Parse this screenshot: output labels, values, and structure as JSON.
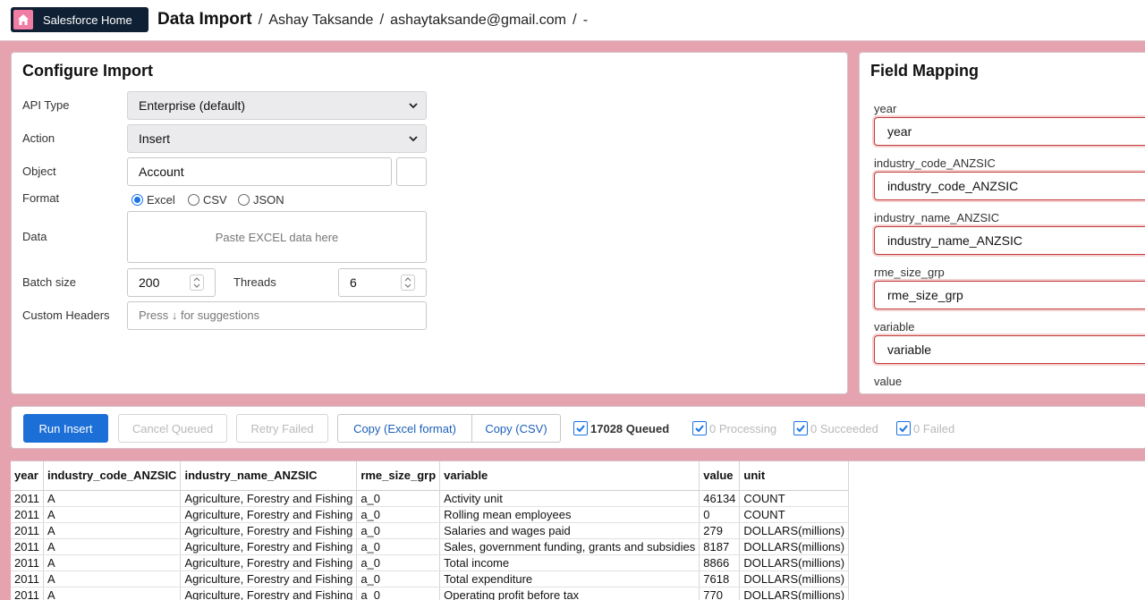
{
  "header": {
    "home_label": "Salesforce Home",
    "title": "Data Import",
    "separator": "/",
    "user_name": "Ashay Taksande",
    "user_email": "ashaytaksande@gmail.com",
    "trailing": "-"
  },
  "configure": {
    "title": "Configure Import",
    "api_type_label": "API Type",
    "api_type_value": "Enterprise (default)",
    "action_label": "Action",
    "action_value": "Insert",
    "object_label": "Object",
    "object_value": "Account",
    "format_label": "Format",
    "format_options": [
      "Excel",
      "CSV",
      "JSON"
    ],
    "format_selected": "Excel",
    "data_label": "Data",
    "data_placeholder": "Paste EXCEL data here",
    "batch_label": "Batch size",
    "batch_value": "200",
    "threads_label": "Threads",
    "threads_value": "6",
    "headers_label": "Custom Headers",
    "headers_placeholder": "Press ↓ for suggestions"
  },
  "field_mapping": {
    "title": "Field Mapping",
    "fields": [
      {
        "label": "year",
        "value": "year"
      },
      {
        "label": "industry_code_ANZSIC",
        "value": "industry_code_ANZSIC"
      },
      {
        "label": "industry_name_ANZSIC",
        "value": "industry_name_ANZSIC"
      },
      {
        "label": "rme_size_grp",
        "value": "rme_size_grp"
      },
      {
        "label": "variable",
        "value": "variable"
      },
      {
        "label": "value",
        "value": ""
      }
    ]
  },
  "actions": {
    "run_label": "Run Insert",
    "cancel_label": "Cancel Queued",
    "retry_label": "Retry Failed",
    "copy_excel_label": "Copy (Excel format)",
    "copy_csv_label": "Copy (CSV)",
    "status": [
      {
        "label": "17028 Queued",
        "active": true
      },
      {
        "label": "0 Processing",
        "active": false
      },
      {
        "label": "0 Succeeded",
        "active": false
      },
      {
        "label": "0 Failed",
        "active": false
      }
    ]
  },
  "table": {
    "columns": [
      "year",
      "industry_code_ANZSIC",
      "industry_name_ANZSIC",
      "rme_size_grp",
      "variable",
      "value",
      "unit"
    ],
    "rows": [
      [
        "2011",
        "A",
        "Agriculture, Forestry and Fishing",
        "a_0",
        "Activity unit",
        "46134",
        "COUNT"
      ],
      [
        "2011",
        "A",
        "Agriculture, Forestry and Fishing",
        "a_0",
        "Rolling mean employees",
        "0",
        "COUNT"
      ],
      [
        "2011",
        "A",
        "Agriculture, Forestry and Fishing",
        "a_0",
        "Salaries and wages paid",
        "279",
        "DOLLARS(millions)"
      ],
      [
        "2011",
        "A",
        "Agriculture, Forestry and Fishing",
        "a_0",
        "Sales, government funding, grants and subsidies",
        "8187",
        "DOLLARS(millions)"
      ],
      [
        "2011",
        "A",
        "Agriculture, Forestry and Fishing",
        "a_0",
        "Total income",
        "8866",
        "DOLLARS(millions)"
      ],
      [
        "2011",
        "A",
        "Agriculture, Forestry and Fishing",
        "a_0",
        "Total expenditure",
        "7618",
        "DOLLARS(millions)"
      ],
      [
        "2011",
        "A",
        "Agriculture, Forestry and Fishing",
        "a_0",
        "Operating profit before tax",
        "770",
        "DOLLARS(millions)"
      ]
    ]
  },
  "colors": {
    "background": "#e4a3af",
    "home_button": "#0f2034",
    "home_icon": "#f07da4",
    "primary": "#1c6fd6",
    "mapping_border": "#c53a3a"
  }
}
